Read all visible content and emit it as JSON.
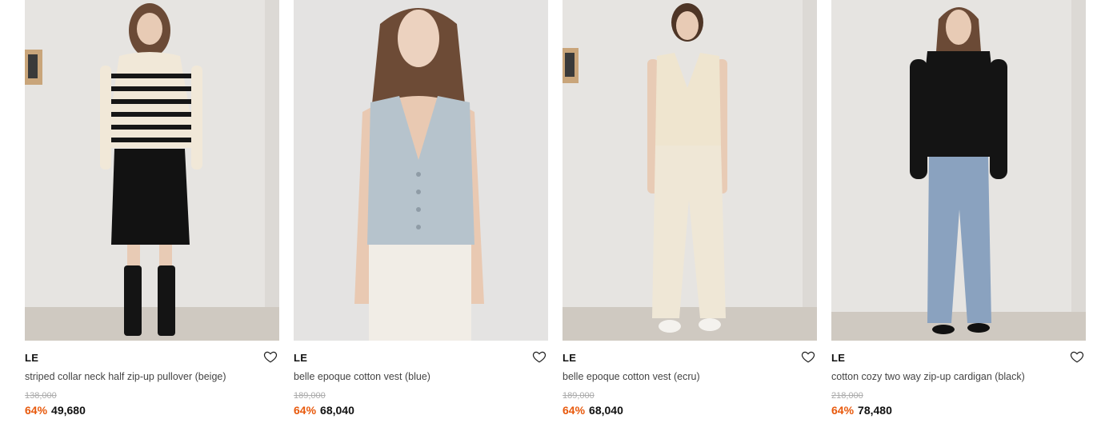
{
  "colors": {
    "discount": "#e8590c",
    "accent_text": "#111111",
    "muted": "#aaaaaa"
  },
  "products": [
    {
      "brand": "LE",
      "name": "striped collar neck half zip-up pullover (beige)",
      "original_price": "138,000",
      "discount": "64%",
      "price": "49,680",
      "image": "model-striped-pullover"
    },
    {
      "brand": "LE",
      "name": "belle epoque cotton vest (blue)",
      "original_price": "189,000",
      "discount": "64%",
      "price": "68,040",
      "image": "model-blue-vest"
    },
    {
      "brand": "LE",
      "name": "belle epoque cotton vest (ecru)",
      "original_price": "189,000",
      "discount": "64%",
      "price": "68,040",
      "image": "model-ecru-vest"
    },
    {
      "brand": "LE",
      "name": "cotton cozy two way zip-up cardigan (black)",
      "original_price": "218,000",
      "discount": "64%",
      "price": "78,480",
      "image": "model-black-cardigan"
    }
  ]
}
